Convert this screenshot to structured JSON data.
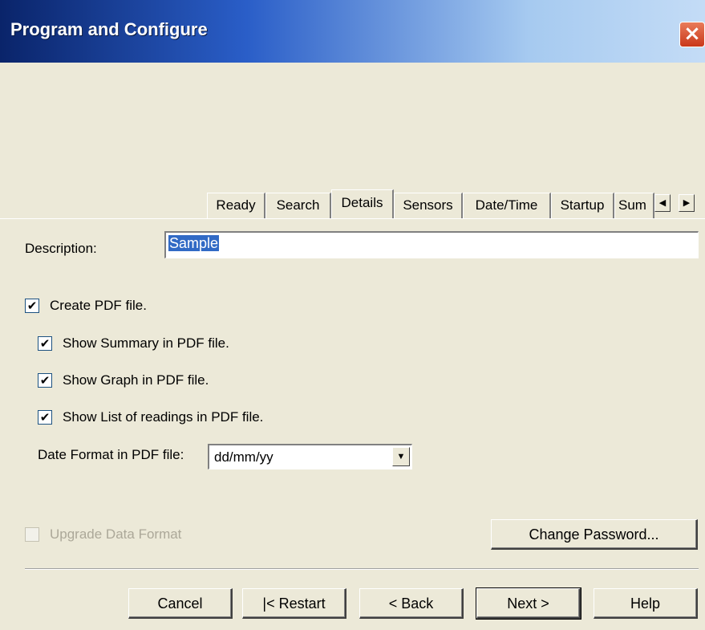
{
  "window": {
    "title": "Program and Configure",
    "close_icon": "close-icon"
  },
  "tabs": [
    {
      "label": "Ready"
    },
    {
      "label": "Search"
    },
    {
      "label": "Details",
      "active": true
    },
    {
      "label": "Sensors"
    },
    {
      "label": "Date/Time"
    },
    {
      "label": "Startup"
    },
    {
      "label": "Sum"
    }
  ],
  "tab_scroll": {
    "left_glyph": "◀",
    "right_glyph": "▶"
  },
  "description": {
    "label": "Description:",
    "value": "Sample"
  },
  "pdf": {
    "create": {
      "label": "Create PDF file.",
      "checked": true
    },
    "summary": {
      "label": "Show Summary in PDF file.",
      "checked": true
    },
    "graph": {
      "label": "Show Graph in PDF file.",
      "checked": true
    },
    "list": {
      "label": "Show List of readings in PDF file.",
      "checked": true
    },
    "date_format": {
      "label": "Date Format in PDF file:",
      "value": "dd/mm/yy"
    }
  },
  "upgrade": {
    "label": "Upgrade Data Format",
    "checked": false,
    "enabled": false
  },
  "buttons": {
    "change_password": "Change Password...",
    "cancel": "Cancel",
    "restart": "|< Restart",
    "back": "< Back",
    "next": "Next >",
    "help": "Help"
  },
  "glyphs": {
    "check": "✔",
    "dropdown": "▼"
  },
  "colors": {
    "selection": "#316ac5",
    "dialog_bg": "#ece9d8"
  }
}
